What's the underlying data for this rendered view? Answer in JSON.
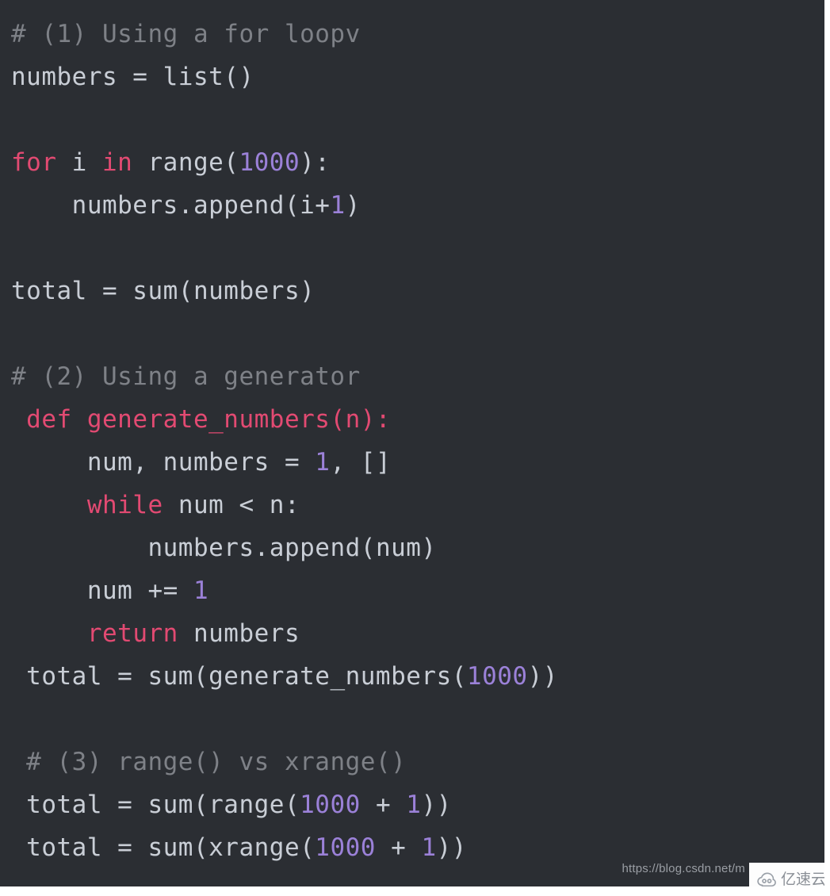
{
  "snippet": {
    "language": "python",
    "theme": {
      "background": "#2b2e33",
      "plain": "#c9ced6",
      "comment": "#7e8187",
      "keyword": "#e24a72",
      "number": "#9b81d8"
    },
    "lines": [
      {
        "indent": "",
        "tokens": [
          {
            "t": "comment",
            "s": "# (1) Using a for loopv"
          }
        ]
      },
      {
        "indent": "",
        "tokens": [
          {
            "t": "plain",
            "s": "numbers = list()"
          }
        ]
      },
      {
        "indent": "",
        "tokens": [
          {
            "t": "plain",
            "s": ""
          }
        ]
      },
      {
        "indent": "",
        "tokens": [
          {
            "t": "kw",
            "s": "for"
          },
          {
            "t": "plain",
            "s": " i "
          },
          {
            "t": "kw",
            "s": "in"
          },
          {
            "t": "plain",
            "s": " range("
          },
          {
            "t": "num",
            "s": "1000"
          },
          {
            "t": "plain",
            "s": "):"
          }
        ]
      },
      {
        "indent": "    ",
        "tokens": [
          {
            "t": "plain",
            "s": "numbers.append(i+"
          },
          {
            "t": "num",
            "s": "1"
          },
          {
            "t": "plain",
            "s": ")"
          }
        ]
      },
      {
        "indent": "",
        "tokens": [
          {
            "t": "plain",
            "s": ""
          }
        ]
      },
      {
        "indent": "",
        "tokens": [
          {
            "t": "plain",
            "s": "total = sum(numbers)"
          }
        ]
      },
      {
        "indent": "",
        "tokens": [
          {
            "t": "plain",
            "s": ""
          }
        ]
      },
      {
        "indent": "",
        "tokens": [
          {
            "t": "comment",
            "s": "# (2) Using a generator"
          }
        ]
      },
      {
        "indent": " ",
        "tokens": [
          {
            "t": "kw",
            "s": "def generate_numbers(n):"
          }
        ]
      },
      {
        "indent": "     ",
        "tokens": [
          {
            "t": "plain",
            "s": "num, numbers = "
          },
          {
            "t": "num",
            "s": "1"
          },
          {
            "t": "plain",
            "s": ", []"
          }
        ]
      },
      {
        "indent": "     ",
        "tokens": [
          {
            "t": "kw",
            "s": "while"
          },
          {
            "t": "plain",
            "s": " num < n:"
          }
        ]
      },
      {
        "indent": "         ",
        "tokens": [
          {
            "t": "plain",
            "s": "numbers.append(num)"
          }
        ]
      },
      {
        "indent": "     ",
        "tokens": [
          {
            "t": "plain",
            "s": "num += "
          },
          {
            "t": "num",
            "s": "1"
          }
        ]
      },
      {
        "indent": "     ",
        "tokens": [
          {
            "t": "kw",
            "s": "return"
          },
          {
            "t": "plain",
            "s": " numbers"
          }
        ]
      },
      {
        "indent": " ",
        "tokens": [
          {
            "t": "plain",
            "s": "total = sum(generate_numbers("
          },
          {
            "t": "num",
            "s": "1000"
          },
          {
            "t": "plain",
            "s": "))"
          }
        ]
      },
      {
        "indent": "",
        "tokens": [
          {
            "t": "plain",
            "s": ""
          }
        ]
      },
      {
        "indent": " ",
        "tokens": [
          {
            "t": "comment",
            "s": "# (3) range() vs xrange()"
          }
        ]
      },
      {
        "indent": " ",
        "tokens": [
          {
            "t": "plain",
            "s": "total = sum(range("
          },
          {
            "t": "num",
            "s": "1000"
          },
          {
            "t": "plain",
            "s": " + "
          },
          {
            "t": "num",
            "s": "1"
          },
          {
            "t": "plain",
            "s": "))"
          }
        ]
      },
      {
        "indent": " ",
        "tokens": [
          {
            "t": "plain",
            "s": "total = sum(xrange("
          },
          {
            "t": "num",
            "s": "1000"
          },
          {
            "t": "plain",
            "s": " + "
          },
          {
            "t": "num",
            "s": "1"
          },
          {
            "t": "plain",
            "s": "))"
          }
        ]
      }
    ]
  },
  "watermark": {
    "url_text": "https://blog.csdn.net/m",
    "brand_text": "亿速云",
    "logo_icon": "cloud-icon",
    "chip_background": "#fdfdfd",
    "logo_color": "#8a8f96"
  }
}
